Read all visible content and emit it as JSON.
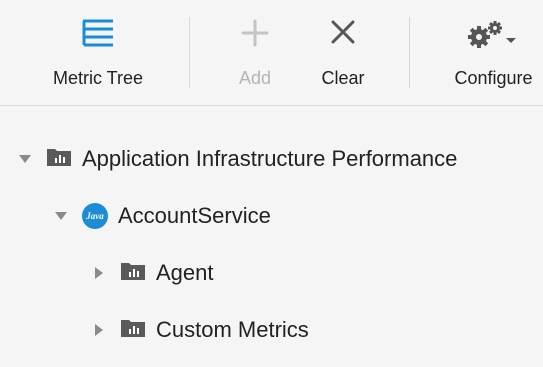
{
  "toolbar": {
    "metric_tree_label": "Metric Tree",
    "add_label": "Add",
    "clear_label": "Clear",
    "configure_label": "Configure"
  },
  "tree": {
    "root": {
      "label": "Application Infrastructure Performance",
      "expanded": true,
      "icon": "folder-chart-icon"
    },
    "service": {
      "label": "AccountService",
      "badge": "Java",
      "expanded": true,
      "icon": "java-icon"
    },
    "children": [
      {
        "label": "Agent",
        "expanded": false,
        "icon": "folder-chart-icon"
      },
      {
        "label": "Custom Metrics",
        "expanded": false,
        "icon": "folder-chart-icon"
      }
    ]
  },
  "colors": {
    "accent": "#1a8dd6",
    "disabled": "#b5b5b5",
    "icon": "#555555"
  }
}
